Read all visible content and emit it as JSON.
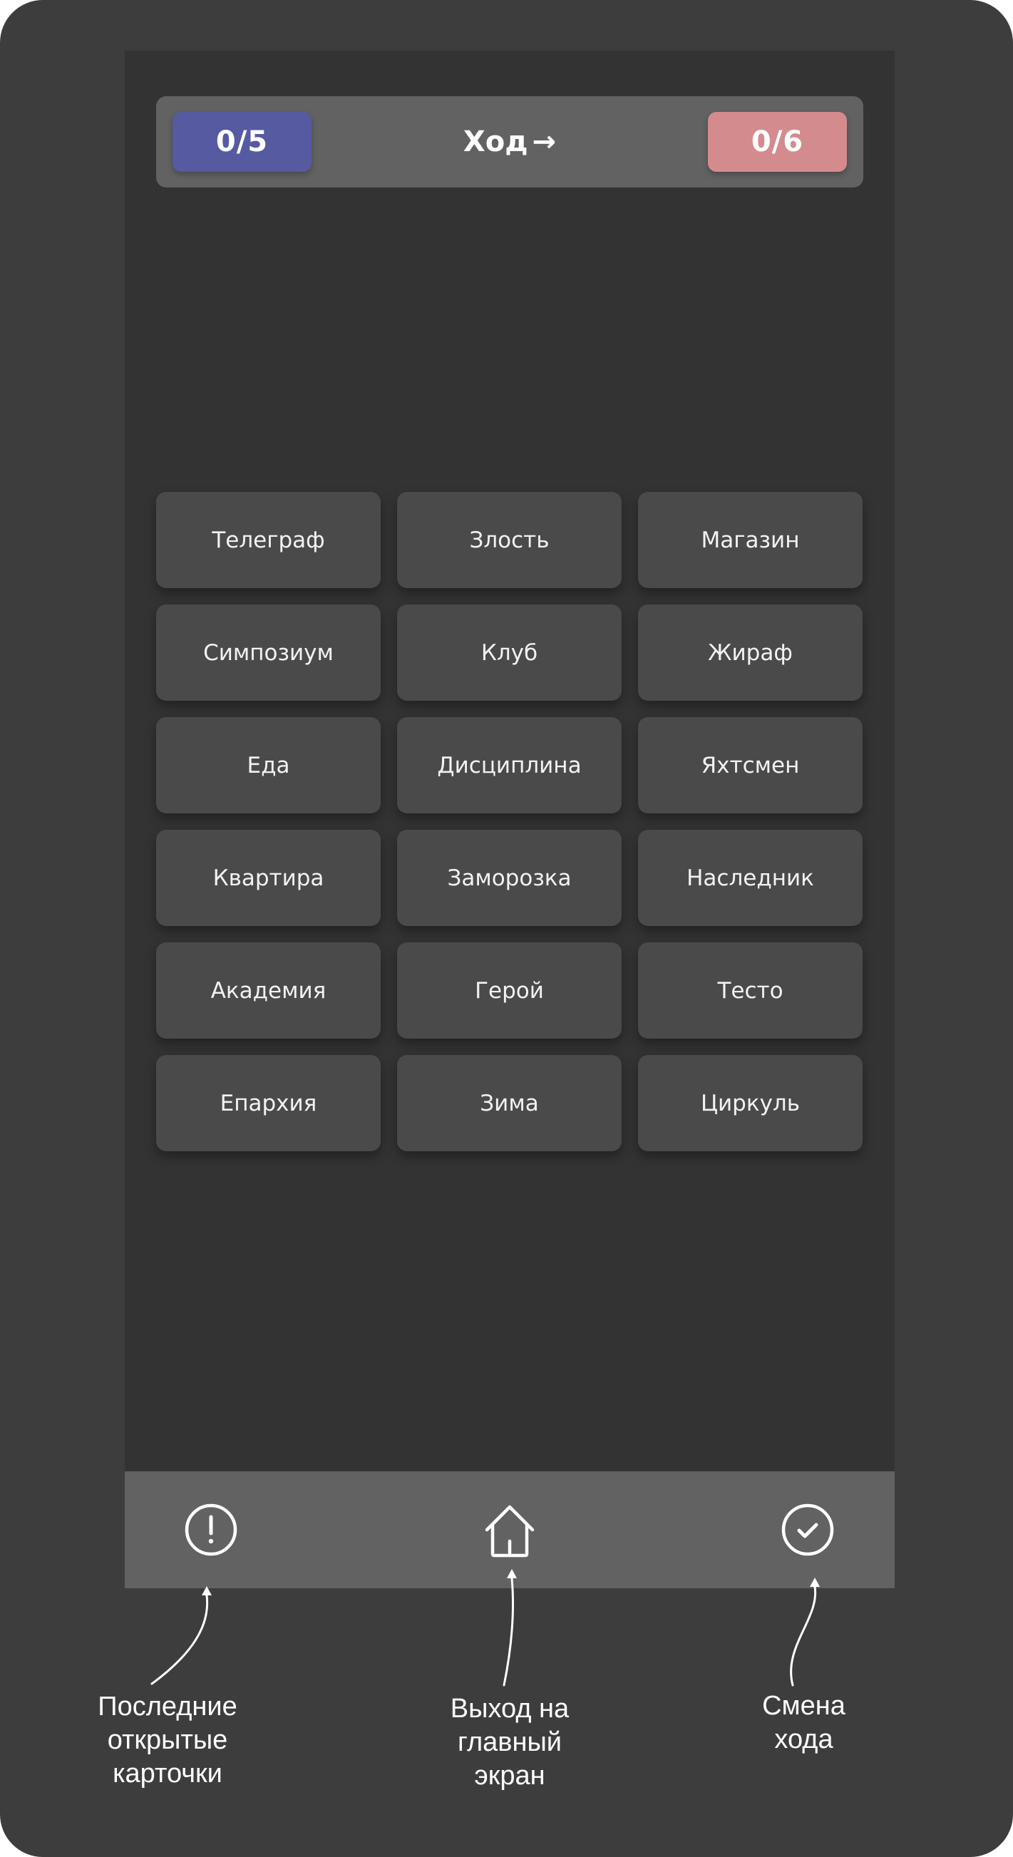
{
  "header": {
    "blue_score": "0/5",
    "turn_label": "Ход",
    "turn_arrow": "→",
    "red_score": "0/6"
  },
  "cards": [
    "Телеграф",
    "Злость",
    "Магазин",
    "Симпозиум",
    "Клуб",
    "Жираф",
    "Еда",
    "Дисциплина",
    "Яхтсмен",
    "Квартира",
    "Заморозка",
    "Наследник",
    "Академия",
    "Герой",
    "Тесто",
    "Епархия",
    "Зима",
    "Циркуль"
  ],
  "bottom_bar": {
    "icons": [
      "alert-circle-icon",
      "home-icon",
      "check-circle-icon"
    ]
  },
  "annotations": {
    "last_opened": "Последние\nоткрытые\nкарточки",
    "exit_home": "Выход на\nглавный\nэкран",
    "change_turn": "Смена\nхода"
  },
  "colors": {
    "blue_team": "#565aa0",
    "red_team": "#d48b8e",
    "background": "#333333",
    "card": "#4a4a4a",
    "bar": "#626262"
  }
}
